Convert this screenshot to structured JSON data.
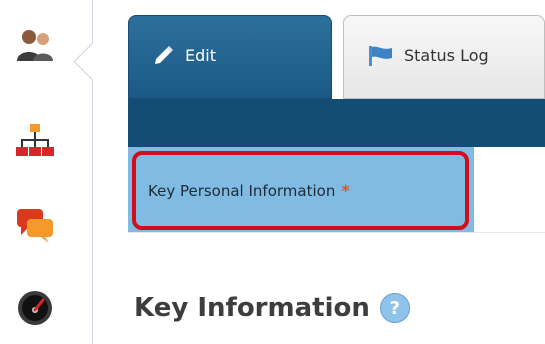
{
  "sidebar": {
    "items": [
      {
        "icon": "users-icon"
      },
      {
        "icon": "org-chart-icon"
      },
      {
        "icon": "chat-icon"
      },
      {
        "icon": "dashboard-icon"
      }
    ]
  },
  "tabs": [
    {
      "label": "Edit",
      "icon": "pencil-icon"
    },
    {
      "label": "Status Log",
      "icon": "flag-icon"
    }
  ],
  "subtab": {
    "label": "Key Personal Information",
    "required_marker": "*"
  },
  "section": {
    "heading": "Key Information",
    "help_label": "?"
  },
  "colors": {
    "accent": "#1b5a86",
    "band": "#114d75",
    "subtab_bg": "#7fbbe3",
    "highlight": "#d10f1a",
    "required": "#d8582c"
  }
}
